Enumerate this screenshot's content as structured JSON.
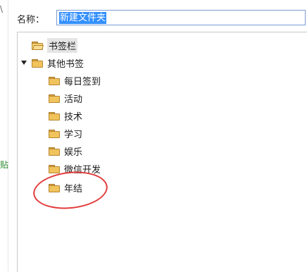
{
  "underlay": {
    "top_char": "\\",
    "side_char": "贴"
  },
  "dialog": {
    "name_label": "名称：",
    "name_value": "新建文件夹"
  },
  "tree": {
    "bookmarks_bar": "书签栏",
    "other_bookmarks": "其他书签",
    "children": [
      "每日签到",
      "活动",
      "技术",
      "学习",
      "娱乐",
      "微信开发",
      "年结"
    ]
  },
  "colors": {
    "selection": "#3390ff",
    "annotation": "#e23b3b",
    "folder": "#f1c35c"
  }
}
